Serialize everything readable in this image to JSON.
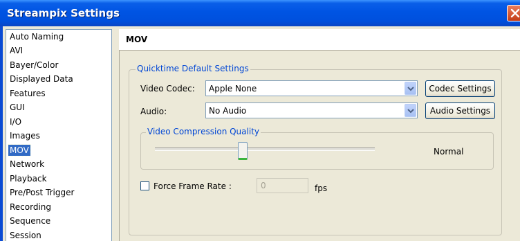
{
  "window": {
    "title": "Streampix Settings"
  },
  "sidebar": {
    "items": [
      {
        "label": "Auto Naming",
        "selected": false
      },
      {
        "label": "AVI",
        "selected": false
      },
      {
        "label": "Bayer/Color",
        "selected": false
      },
      {
        "label": "Displayed Data",
        "selected": false
      },
      {
        "label": "Features",
        "selected": false
      },
      {
        "label": "GUI",
        "selected": false
      },
      {
        "label": "I/O",
        "selected": false
      },
      {
        "label": "Images",
        "selected": false
      },
      {
        "label": "MOV",
        "selected": true
      },
      {
        "label": "Network",
        "selected": false
      },
      {
        "label": "Playback",
        "selected": false
      },
      {
        "label": "Pre/Post Trigger",
        "selected": false
      },
      {
        "label": "Recording",
        "selected": false
      },
      {
        "label": "Sequence",
        "selected": false
      },
      {
        "label": "Session",
        "selected": false
      }
    ]
  },
  "panel": {
    "title": "MOV",
    "quicktime_group": {
      "title": "Quicktime Default Settings",
      "video_codec_label": "Video Codec:",
      "video_codec_value": "Apple None",
      "codec_settings_button": "Codec Settings",
      "audio_label": "Audio:",
      "audio_value": "No Audio",
      "audio_settings_button": "Audio Settings"
    },
    "compression_group": {
      "title": "Video Compression Quality",
      "quality_value": "Normal",
      "slider_level": 0.38
    },
    "force_frame_rate": {
      "label": "Force Frame Rate :",
      "checked": false,
      "value": "0",
      "unit": "fps"
    }
  },
  "colors": {
    "titlebar": "#0054e3",
    "selection": "#316ac5",
    "group_title": "#0046d5",
    "close_button": "#c33c16"
  },
  "icons": {
    "close": "close-icon",
    "dropdown": "chevron-down-icon"
  }
}
